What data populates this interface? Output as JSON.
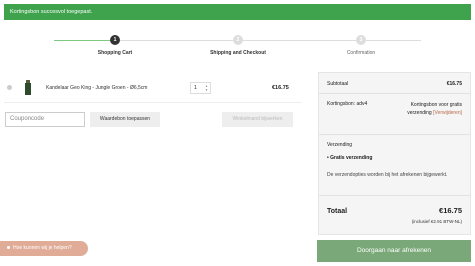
{
  "notice": {
    "message": "Kortingsbon succesvol toegepast."
  },
  "steps": [
    {
      "number": "1",
      "label": "Shopping Cart"
    },
    {
      "number": "2",
      "label": "Shipping and Checkout"
    },
    {
      "number": "3",
      "label": "Confirmation"
    }
  ],
  "cart": {
    "items": [
      {
        "name": "Kandelaar Geo King - Jungle Groen - Ø6,5cm",
        "quantity": "1",
        "price": "€16.75"
      }
    ],
    "coupon_placeholder": "Couponcode",
    "apply_label": "Waardebon toepassen",
    "update_label": "Winkelmand bijwerken"
  },
  "summary": {
    "subtotal_label": "Subtotaal",
    "subtotal_value": "€16.75",
    "coupon_label": "Kortingsbon: adv4",
    "coupon_value": "Kortingsbon voor gratis verzending",
    "coupon_remove": "[Verwijderen]",
    "shipping_label": "Verzending",
    "shipping_option": "Gratis verzending",
    "shipping_note": "De verzendopties worden bij het afrekenen bijgewerkt.",
    "total_label": "Totaal",
    "total_value": "€16.75",
    "vat_note": "(inclusief €2.91 BTW-NL)"
  },
  "checkout_label": "Doorgaan naar afrekenen",
  "help_label": "Hoe kunnen wij je helpen?",
  "colors": {
    "success": "#3fa34d",
    "checkout": "#7aa878",
    "help": "#e0ac98"
  }
}
